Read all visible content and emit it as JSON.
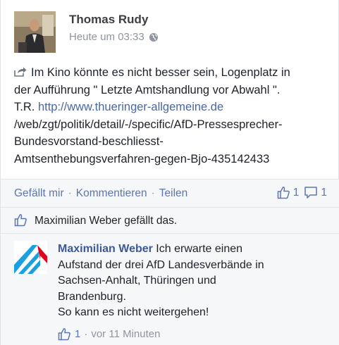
{
  "post": {
    "author": "Thomas Rudy",
    "timestamp": "Heute um 03:33",
    "privacy_icon": "globe-icon",
    "body_lines": [
      "Im Kino könnte es nicht besser sein, Logenplatz in",
      "der Aufführung \" Letzte Amtshandlung vor Abwahl \".",
      "T.R."
    ],
    "link_text": "http://www.thueringer-allgemeine.de",
    "link_lines": [
      "/web/zgt/politik/detail/-/specific/AfD-Pressesprecher-",
      "Bundesvorstand-beschliesst-",
      "Amtsenthebungsverfahren-gegen-Bjo-435142433"
    ]
  },
  "actions": {
    "like": "Gefällt mir",
    "separator": "·",
    "comment": "Kommentieren",
    "share": "Teilen",
    "like_count": "1",
    "comment_count": "1"
  },
  "likes_summary": "Maximilian Weber gefällt das.",
  "comment": {
    "author": "Maximilian Weber",
    "text_lines": [
      " Ich erwarte einen",
      "Aufstand der drei AfD Landesverbände in",
      "Sachsen-Anhalt, Thüringen und",
      "Brandenburg.",
      "So kann es nicht weitergehen!"
    ],
    "like_count": "1",
    "separator": "·",
    "time": "vor 11 Minuten"
  },
  "colors": {
    "link": "#4b67a1",
    "action": "#5d76ae",
    "author": "#3b5998",
    "afd_blue": "#1aa0e0",
    "afd_red": "#e2001a"
  }
}
